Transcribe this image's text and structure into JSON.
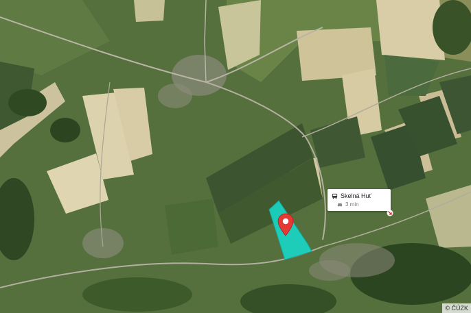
{
  "map": {
    "type": "satellite",
    "colors": {
      "parcel_fill": "#18d6c8",
      "parcel_stroke": "#12a89c",
      "marker": "#e53935",
      "field_light": "#d6cba2",
      "forest": "#2f4a22"
    },
    "icons": {
      "location_marker": "location-pin-icon",
      "bus": "bus-icon",
      "car": "car-icon",
      "arrow": "arrow-icon"
    }
  },
  "popup": {
    "place_name": "Skelná Huť",
    "travel_time": "3 min"
  },
  "copyright": "© ČÚZK"
}
